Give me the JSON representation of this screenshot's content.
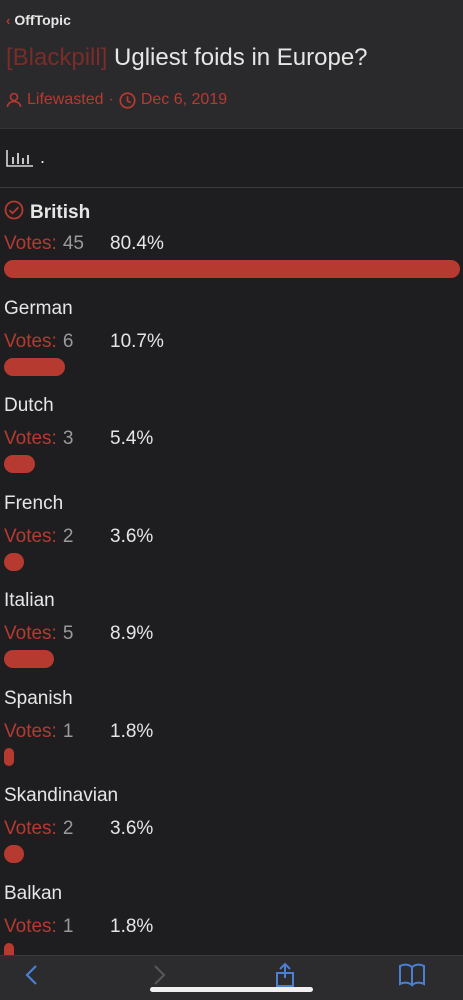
{
  "breadcrumb": {
    "label": "OffTopic"
  },
  "thread": {
    "prefix": "[Blackpill]",
    "title": "Ugliest foids in Europe?",
    "author": "Lifewasted",
    "date": "Dec 6, 2019"
  },
  "toolbar": {
    "more_label": "."
  },
  "poll": {
    "votes_label": "Votes:",
    "options": [
      {
        "label": "British",
        "votes": "45",
        "percent": "80.4%",
        "fraction": 0.804,
        "voted": true
      },
      {
        "label": "German",
        "votes": "6",
        "percent": "10.7%",
        "fraction": 0.107
      },
      {
        "label": "Dutch",
        "votes": "3",
        "percent": "5.4%",
        "fraction": 0.054
      },
      {
        "label": "French",
        "votes": "2",
        "percent": "3.6%",
        "fraction": 0.036
      },
      {
        "label": "Italian",
        "votes": "5",
        "percent": "8.9%",
        "fraction": 0.089
      },
      {
        "label": "Spanish",
        "votes": "1",
        "percent": "1.8%",
        "fraction": 0.018
      },
      {
        "label": "Skandinavian",
        "votes": "2",
        "percent": "3.6%",
        "fraction": 0.036
      },
      {
        "label": "Balkan",
        "votes": "1",
        "percent": "1.8%",
        "fraction": 0.018
      }
    ]
  },
  "colors": {
    "accent": "#b63a30",
    "background": "#1e1e20",
    "header": "#2a2a2c"
  },
  "icons": [
    "chevron-left-icon",
    "user-icon",
    "clock-icon",
    "bar-chart-icon",
    "check-circle-icon",
    "back-arrow-icon",
    "forward-arrow-icon",
    "share-icon",
    "bookmarks-icon"
  ]
}
